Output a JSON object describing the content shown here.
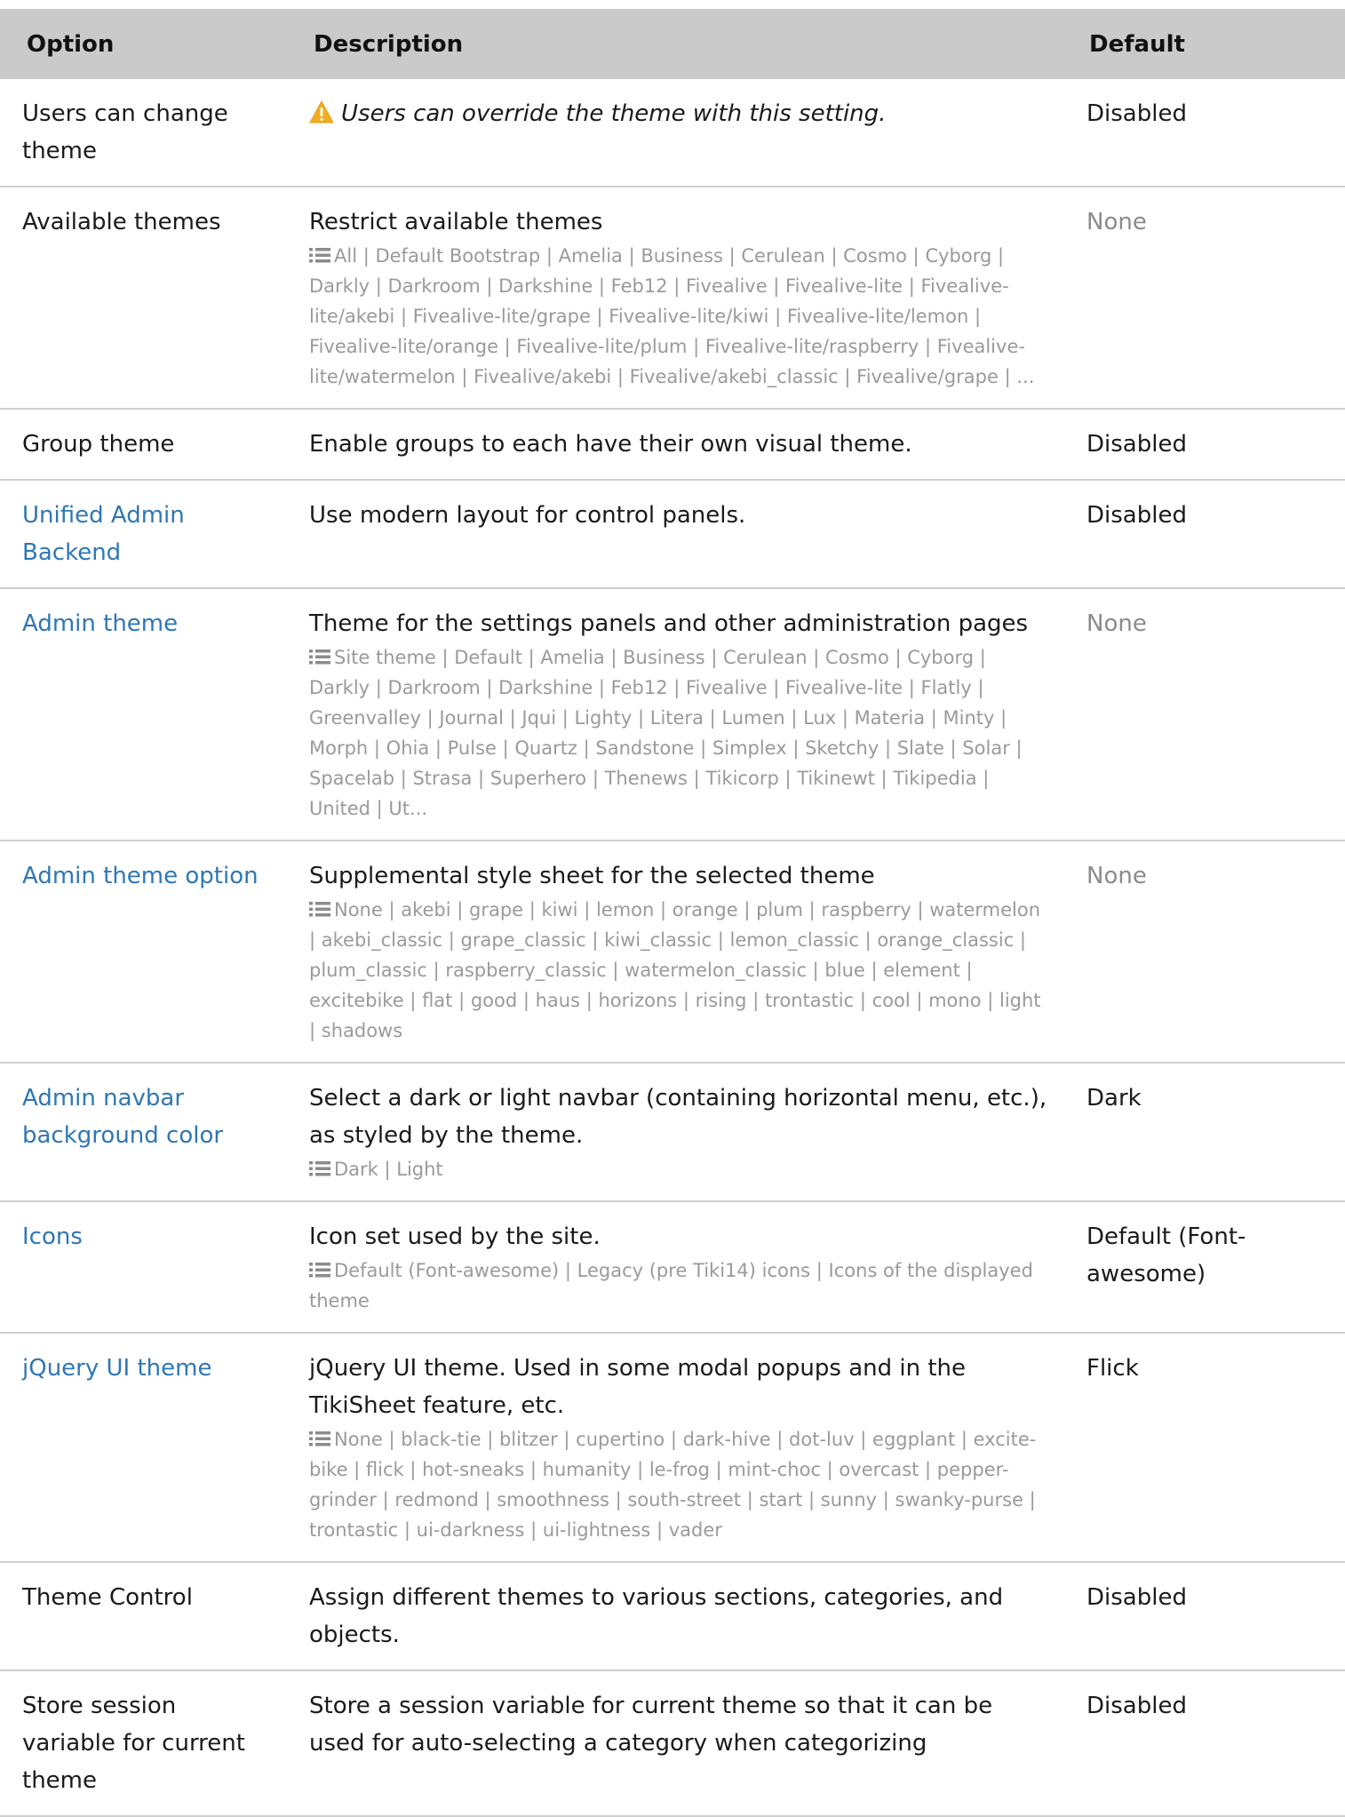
{
  "headers": {
    "option": "Option",
    "description": "Description",
    "default": "Default"
  },
  "rows": [
    {
      "option": "Users can change theme",
      "option_link": false,
      "description": "Users can override the theme with this setting.",
      "warning": true,
      "options_list": "",
      "default": "Disabled",
      "default_muted": false
    },
    {
      "option": "Available themes",
      "option_link": false,
      "description": "Restrict available themes",
      "warning": false,
      "options_list": "All | Default Bootstrap | Amelia | Business | Cerulean | Cosmo | Cyborg | Darkly | Darkroom | Darkshine | Feb12 | Fivealive | Fivealive-lite | Fivealive-lite/akebi | Fivealive-lite/grape | Fivealive-lite/kiwi | Fivealive-lite/lemon | Fivealive-lite/orange | Fivealive-lite/plum | Fivealive-lite/raspberry | Fivealive-lite/watermelon | Fivealive/akebi | Fivealive/akebi_classic | Fivealive/grape | ...",
      "default": "None",
      "default_muted": true
    },
    {
      "option": "Group theme",
      "option_link": false,
      "description": "Enable groups to each have their own visual theme.",
      "warning": false,
      "options_list": "",
      "default": "Disabled",
      "default_muted": false
    },
    {
      "option": "Unified Admin Backend",
      "option_link": true,
      "description": "Use modern layout for control panels.",
      "warning": false,
      "options_list": "",
      "default": "Disabled",
      "default_muted": false
    },
    {
      "option": "Admin theme",
      "option_link": true,
      "description": "Theme for the settings panels and other administration pages",
      "warning": false,
      "options_list": "Site theme | Default | Amelia | Business | Cerulean | Cosmo | Cyborg | Darkly | Darkroom | Darkshine | Feb12 | Fivealive | Fivealive-lite | Flatly | Greenvalley | Journal | Jqui | Lighty | Litera | Lumen | Lux | Materia | Minty | Morph | Ohia | Pulse | Quartz | Sandstone | Simplex | Sketchy | Slate | Solar | Spacelab | Strasa | Superhero | Thenews | Tikicorp | Tikinewt | Tikipedia | United | Ut...",
      "default": "None",
      "default_muted": true
    },
    {
      "option": "Admin theme option",
      "option_link": true,
      "description": "Supplemental style sheet for the selected theme",
      "warning": false,
      "options_list": "None | akebi | grape | kiwi | lemon | orange | plum | raspberry | watermelon | akebi_classic | grape_classic | kiwi_classic | lemon_classic | orange_classic | plum_classic | raspberry_classic | watermelon_classic | blue | element | excitebike | flat | good | haus | horizons | rising | trontastic | cool | mono | light | shadows",
      "default": "None",
      "default_muted": true
    },
    {
      "option": "Admin navbar background color",
      "option_link": true,
      "description": "Select a dark or light navbar (containing horizontal menu, etc.), as styled by the theme.",
      "warning": false,
      "options_list": "Dark | Light",
      "default": "Dark",
      "default_muted": false
    },
    {
      "option": "Icons",
      "option_link": true,
      "description": "Icon set used by the site.",
      "warning": false,
      "options_list": "Default (Font-awesome) | Legacy (pre Tiki14) icons | Icons of the displayed theme",
      "default": "Default (Font-awesome)",
      "default_muted": false
    },
    {
      "option": "jQuery UI theme",
      "option_link": true,
      "description": "jQuery UI theme. Used in some modal popups and in the TikiSheet feature, etc.",
      "warning": false,
      "options_list": "None | black-tie | blitzer | cupertino | dark-hive | dot-luv | eggplant | excite-bike | flick | hot-sneaks | humanity | le-frog | mint-choc | overcast | pepper-grinder | redmond | smoothness | south-street | start | sunny | swanky-purse | trontastic | ui-darkness | ui-lightness | vader",
      "default": "Flick",
      "default_muted": false
    },
    {
      "option": "Theme Control",
      "option_link": false,
      "description": "Assign different themes to various sections, categories, and objects.",
      "warning": false,
      "options_list": "",
      "default": "Disabled",
      "default_muted": false
    },
    {
      "option": "Store session variable for current theme",
      "option_link": false,
      "description": "Store a session variable for current theme so that it can be used for auto-selecting a category when categorizing",
      "warning": false,
      "options_list": "",
      "default": "Disabled",
      "default_muted": false
    }
  ],
  "colors": {
    "link": "#2f77b4",
    "header_bg": "#cacaca",
    "muted": "#8b8b8b",
    "warning": "#f0ad1e"
  }
}
